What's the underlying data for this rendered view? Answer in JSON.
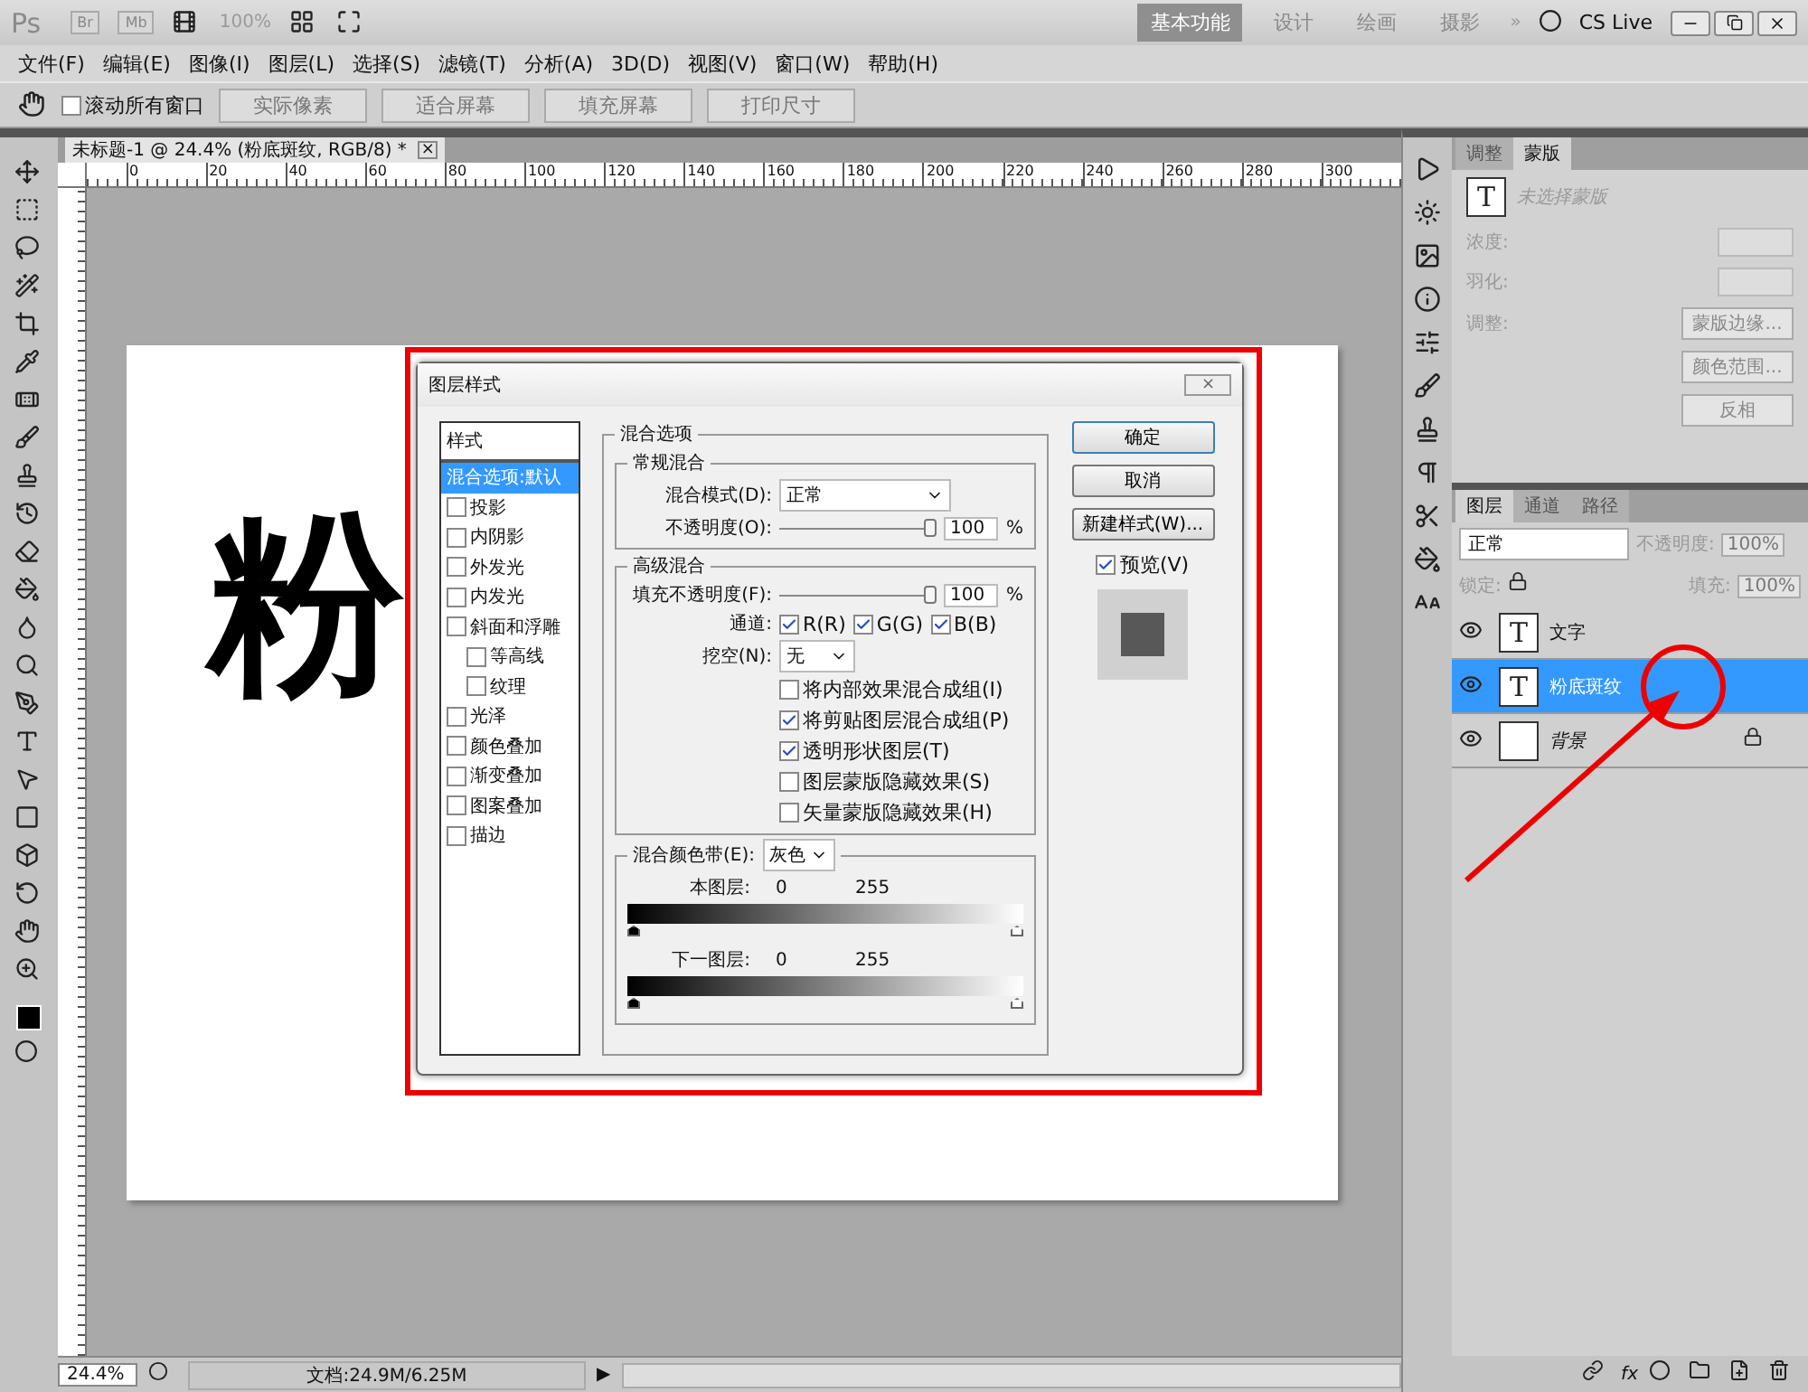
{
  "app_bar": {
    "logo": "Ps",
    "badges": [
      "Br",
      "Mb"
    ],
    "zoom": "100%",
    "workspaces": [
      {
        "label": "基本功能",
        "selected": true
      },
      {
        "label": "设计",
        "selected": false
      },
      {
        "label": "绘画",
        "selected": false
      },
      {
        "label": "摄影",
        "selected": false
      }
    ],
    "more": "»",
    "cs_live": "CS Live"
  },
  "menu": [
    "文件(F)",
    "编辑(E)",
    "图像(I)",
    "图层(L)",
    "选择(S)",
    "滤镜(T)",
    "分析(A)",
    "3D(D)",
    "视图(V)",
    "窗口(W)",
    "帮助(H)"
  ],
  "options_bar": {
    "scroll_all": {
      "label": "滚动所有窗口",
      "checked": false
    },
    "buttons": [
      "实际像素",
      "适合屏幕",
      "填充屏幕",
      "打印尺寸"
    ]
  },
  "document": {
    "tab": {
      "title": "未标题-1 @ 24.4% (粉底斑纹, RGB/8) *",
      "close": "×",
      "selected": true
    },
    "ruler": [
      "0",
      "20",
      "40",
      "60",
      "80",
      "100",
      "120",
      "140",
      "160",
      "180",
      "200",
      "220",
      "240",
      "260",
      "280",
      "300"
    ],
    "canvas_text": "粉"
  },
  "status_bar": {
    "zoom": "24.4%",
    "doc_info": "文档:24.9M/6.25M",
    "arrow": "▶"
  },
  "dialog": {
    "title": "图层样式",
    "close": "×",
    "styles_header": "样式",
    "styles": [
      {
        "label": "混合选项:默认",
        "kind": "plain",
        "selected": true
      },
      {
        "label": "投影",
        "kind": "check",
        "checked": false,
        "selected": false
      },
      {
        "label": "内阴影",
        "kind": "check",
        "checked": false,
        "selected": false
      },
      {
        "label": "外发光",
        "kind": "check",
        "checked": false,
        "selected": false
      },
      {
        "label": "内发光",
        "kind": "check",
        "checked": false,
        "selected": false
      },
      {
        "label": "斜面和浮雕",
        "kind": "check",
        "checked": false,
        "selected": false,
        "children": [
          {
            "label": "等高线",
            "kind": "check",
            "checked": false,
            "selected": false
          },
          {
            "label": "纹理",
            "kind": "check",
            "checked": false,
            "selected": false
          }
        ]
      },
      {
        "label": "光泽",
        "kind": "check",
        "checked": false,
        "selected": false
      },
      {
        "label": "颜色叠加",
        "kind": "check",
        "checked": false,
        "selected": false
      },
      {
        "label": "渐变叠加",
        "kind": "check",
        "checked": false,
        "selected": false
      },
      {
        "label": "图案叠加",
        "kind": "check",
        "checked": false,
        "selected": false
      },
      {
        "label": "描边",
        "kind": "check",
        "checked": false,
        "selected": false
      }
    ],
    "blend_title": "混合选项",
    "general": {
      "title": "常规混合",
      "mode_label": "混合模式(D):",
      "mode": "正常",
      "opacity_label": "不透明度(O):",
      "opacity": {
        "level": 1,
        "value": "100",
        "unit": "%"
      }
    },
    "advanced": {
      "title": "高级混合",
      "fill_label": "填充不透明度(F):",
      "fill": {
        "level": 1,
        "value": "100",
        "unit": "%"
      },
      "channels_label": "通道:",
      "channels": [
        {
          "label": "R(R)",
          "checked": true
        },
        {
          "label": "G(G)",
          "checked": true
        },
        {
          "label": "B(B)",
          "checked": true
        }
      ],
      "knockout_label": "挖空(N):",
      "knockout": "无",
      "options": [
        {
          "label": "将内部效果混合成组(I)",
          "checked": false
        },
        {
          "label": "将剪贴图层混合成组(P)",
          "checked": true
        },
        {
          "label": "透明形状图层(T)",
          "checked": true
        },
        {
          "label": "图层蒙版隐藏效果(S)",
          "checked": false
        },
        {
          "label": "矢量蒙版隐藏效果(H)",
          "checked": false
        }
      ]
    },
    "blend_if": {
      "label": "混合颜色带(E):",
      "value": "灰色",
      "bands": [
        {
          "label": "本图层:",
          "low": "0",
          "high": "255",
          "thumbs": [
            {
              "level": 0
            },
            {
              "level": 1
            }
          ]
        },
        {
          "label": "下一图层:",
          "low": "0",
          "high": "255",
          "thumbs": [
            {
              "level": 0
            },
            {
              "level": 1
            }
          ]
        }
      ]
    },
    "buttons": [
      {
        "label": "确定",
        "default": true
      },
      {
        "label": "取消",
        "default": false
      },
      {
        "label": "新建样式(W)...",
        "default": false
      }
    ],
    "preview": {
      "label": "预览(V)",
      "checked": true
    }
  },
  "masks_panel": {
    "thumb_letter": "T",
    "tabs": [
      {
        "label": "调整",
        "selected": false
      },
      {
        "label": "蒙版",
        "selected": true
      }
    ],
    "status": "未选择蒙版",
    "density_label": "浓度:",
    "feather_label": "羽化:",
    "refine_label": "调整:",
    "buttons": [
      "蒙版边缘...",
      "颜色范围...",
      "反相"
    ]
  },
  "layers_panel": {
    "tabs": [
      {
        "label": "图层",
        "selected": true
      },
      {
        "label": "通道",
        "selected": false
      },
      {
        "label": "路径",
        "selected": false
      }
    ],
    "mode": "正常",
    "opacity_label": "不透明度:",
    "opacity": "100%",
    "lock_label": "锁定:",
    "fill_label": "填充:",
    "fill": "100%",
    "layers": [
      {
        "name": "文字",
        "kind": "text",
        "thumb": "T",
        "selected": false,
        "locked": false
      },
      {
        "name": "粉底斑纹",
        "kind": "text",
        "thumb": "T",
        "selected": true,
        "locked": false
      },
      {
        "name": "背景",
        "kind": "background",
        "selected": false,
        "locked": true
      }
    ],
    "footer_fx": "fx"
  }
}
